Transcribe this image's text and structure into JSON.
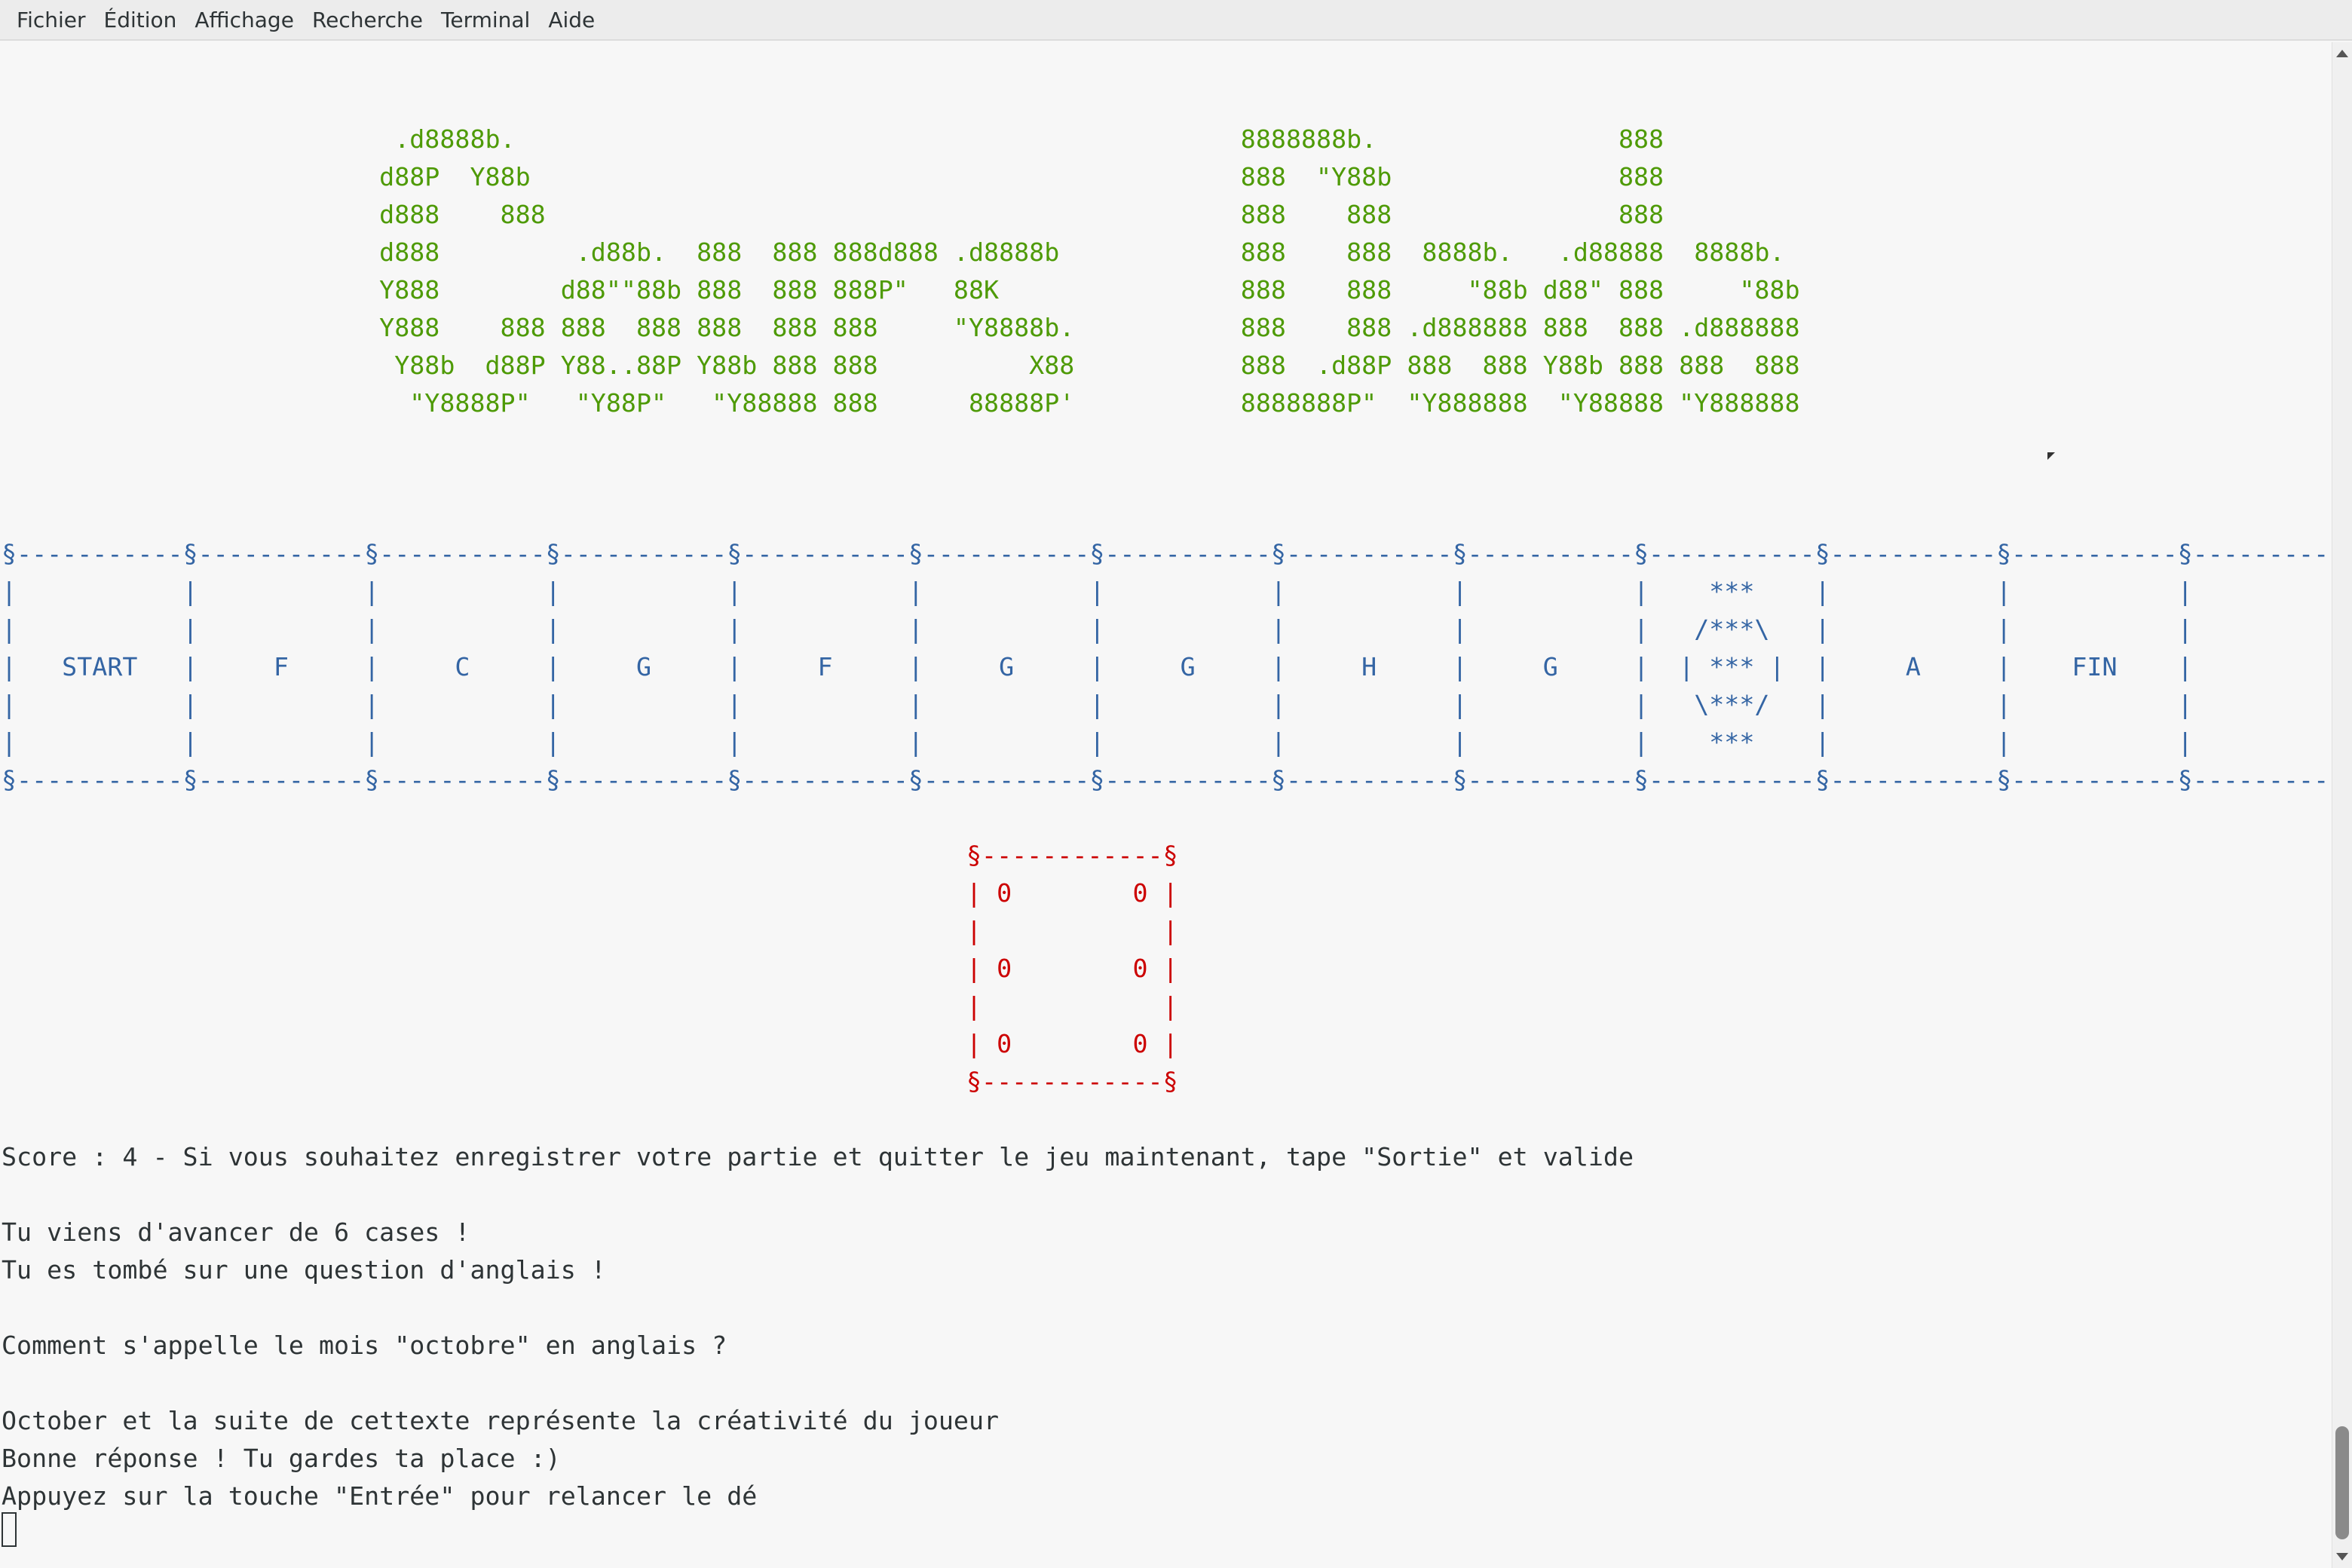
{
  "menubar": {
    "items": [
      "Fichier",
      "Édition",
      "Affichage",
      "Recherche",
      "Terminal",
      "Aide"
    ]
  },
  "terminal": {
    "banner": "                          .d8888b.                                                8888888b.                888\n                         d88P  Y88b                                               888  \"Y88b               888\n                         d888    888                                              888    888               888\n                         d888         .d88b.  888  888 888d888 .d8888b            888    888  8888b.   .d88888  8888b.\n                         Y888        d88\"\"88b 888  888 888P\"   88K                888    888     \"88b d88\" 888     \"88b\n                         Y888    888 888  888 888  888 888     \"Y8888b.           888    888 .d888888 888  888 .d888888\n                          Y88b  d88P Y88..88P Y88b 888 888          X88           888  .d88P 888  888 Y88b 888 888  888\n                           \"Y8888P\"   \"Y88P\"   \"Y88888 888      88888P'           8888888P\"  \"Y888888  \"Y88888 \"Y888888",
    "board": {
      "border_top": "§-----------§-----------§-----------§-----------§-----------§-----------§-----------§-----------§-----------§-----------§-----------§-----------§-----------§",
      "row1": "|           |           |           |           |           |           |           |           |           |    ***    |           |           |           |",
      "row2": "|           |           |           |           |           |           |           |           |           |   /***\\   |           |           |           |",
      "row3": "|   START   |     F     |     C     |     G     |     F     |     G     |     G     |     H     |     G     |  | *** |  |     A     |    FIN    |",
      "row4": "|           |           |           |           |           |           |           |           |           |   \\***/   |           |           |           |",
      "row5": "|           |           |           |           |           |           |           |           |           |    ***    |           |           |           |",
      "border_bottom": "§-----------§-----------§-----------§-----------§-----------§-----------§-----------§-----------§-----------§-----------§-----------§-----------§-----------§"
    },
    "dice": "§------------§\n| 0        0 |\n|            |\n| 0        0 |\n|            |\n| 0        0 |\n§------------§",
    "output": "Score : 4 - Si vous souhaitez enregistrer votre partie et quitter le jeu maintenant, tape \"Sortie\" et valide\n\nTu viens d'avancer de 6 cases !\nTu es tombé sur une question d'anglais !\n\nComment s'appelle le mois \"octobre\" en anglais ?\n\nOctober et la suite de cettexte représente la créativité du joueur\nBonne réponse ! Tu gardes ta place :)\nAppuyez sur la touche \"Entrée\" pour relancer le dé"
  },
  "colors": {
    "banner": "#4e9a06",
    "board": "#3465a4",
    "dice": "#cc0000",
    "text": "#2e3436",
    "background": "#f7f7f7"
  }
}
